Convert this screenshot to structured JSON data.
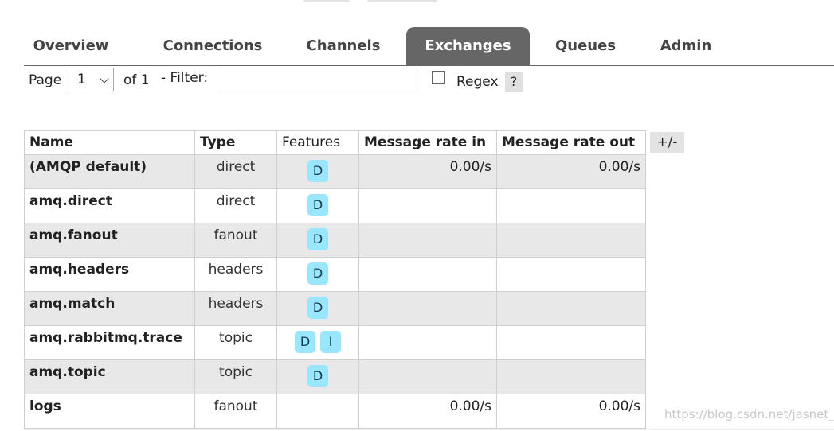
{
  "tabs": [
    "Overview",
    "Connections",
    "Channels",
    "Exchanges",
    "Queues",
    "Admin"
  ],
  "active_tab": "Exchanges",
  "paging": {
    "page_label": "Page",
    "page_value": "1",
    "of_label": "of 1",
    "filter_label": "- Filter:",
    "filter_value": "",
    "regex_label": "Regex",
    "help_label": "?"
  },
  "table": {
    "headers": [
      "Name",
      "Type",
      "Features",
      "Message rate in",
      "Message rate out"
    ],
    "column_toggle": "+/-",
    "rows": [
      {
        "name": "(AMQP default)",
        "type": "direct",
        "features": [
          "D"
        ],
        "rate_in": "0.00/s",
        "rate_out": "0.00/s"
      },
      {
        "name": "amq.direct",
        "type": "direct",
        "features": [
          "D"
        ],
        "rate_in": "",
        "rate_out": ""
      },
      {
        "name": "amq.fanout",
        "type": "fanout",
        "features": [
          "D"
        ],
        "rate_in": "",
        "rate_out": ""
      },
      {
        "name": "amq.headers",
        "type": "headers",
        "features": [
          "D"
        ],
        "rate_in": "",
        "rate_out": ""
      },
      {
        "name": "amq.match",
        "type": "headers",
        "features": [
          "D"
        ],
        "rate_in": "",
        "rate_out": ""
      },
      {
        "name": "amq.rabbitmq.trace",
        "type": "topic",
        "features": [
          "D",
          "I"
        ],
        "rate_in": "",
        "rate_out": ""
      },
      {
        "name": "amq.topic",
        "type": "topic",
        "features": [
          "D"
        ],
        "rate_in": "",
        "rate_out": ""
      },
      {
        "name": "logs",
        "type": "fanout",
        "features": [],
        "rate_in": "0.00/s",
        "rate_out": "0.00/s"
      }
    ]
  },
  "watermark": "https://blog.csdn.net/jasnet_u",
  "colors": {
    "active_tab_bg": "#666666",
    "badge_bg": "#99e6ff",
    "row_alt_bg": "#e8e8e8"
  }
}
